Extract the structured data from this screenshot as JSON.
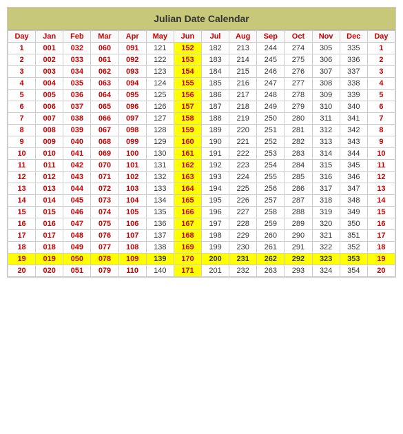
{
  "title": "Julian Date Calendar",
  "headers": [
    "Day",
    "Jan",
    "Feb",
    "Mar",
    "Apr",
    "May",
    "Jun",
    "Jul",
    "Aug",
    "Sep",
    "Oct",
    "Nov",
    "Dec",
    "Day"
  ],
  "rows": [
    {
      "day": 1,
      "jan": "001",
      "feb": "032",
      "mar": "060",
      "apr": "091",
      "may": "121",
      "jun": "152",
      "jul": "182",
      "aug": "213",
      "sep": "244",
      "oct": "274",
      "nov": "305",
      "dec": "335"
    },
    {
      "day": 2,
      "jan": "002",
      "feb": "033",
      "mar": "061",
      "apr": "092",
      "may": "122",
      "jun": "153",
      "jul": "183",
      "aug": "214",
      "sep": "245",
      "oct": "275",
      "nov": "306",
      "dec": "336"
    },
    {
      "day": 3,
      "jan": "003",
      "feb": "034",
      "mar": "062",
      "apr": "093",
      "may": "123",
      "jun": "154",
      "jul": "184",
      "aug": "215",
      "sep": "246",
      "oct": "276",
      "nov": "307",
      "dec": "337"
    },
    {
      "day": 4,
      "jan": "004",
      "feb": "035",
      "mar": "063",
      "apr": "094",
      "may": "124",
      "jun": "155",
      "jul": "185",
      "aug": "216",
      "sep": "247",
      "oct": "277",
      "nov": "308",
      "dec": "338"
    },
    {
      "day": 5,
      "jan": "005",
      "feb": "036",
      "mar": "064",
      "apr": "095",
      "may": "125",
      "jun": "156",
      "jul": "186",
      "aug": "217",
      "sep": "248",
      "oct": "278",
      "nov": "309",
      "dec": "339"
    },
    {
      "day": 6,
      "jan": "006",
      "feb": "037",
      "mar": "065",
      "apr": "096",
      "may": "126",
      "jun": "157",
      "jul": "187",
      "aug": "218",
      "sep": "249",
      "oct": "279",
      "nov": "310",
      "dec": "340"
    },
    {
      "day": 7,
      "jan": "007",
      "feb": "038",
      "mar": "066",
      "apr": "097",
      "may": "127",
      "jun": "158",
      "jul": "188",
      "aug": "219",
      "sep": "250",
      "oct": "280",
      "nov": "311",
      "dec": "341"
    },
    {
      "day": 8,
      "jan": "008",
      "feb": "039",
      "mar": "067",
      "apr": "098",
      "may": "128",
      "jun": "159",
      "jul": "189",
      "aug": "220",
      "sep": "251",
      "oct": "281",
      "nov": "312",
      "dec": "342"
    },
    {
      "day": 9,
      "jan": "009",
      "feb": "040",
      "mar": "068",
      "apr": "099",
      "may": "129",
      "jun": "160",
      "jul": "190",
      "aug": "221",
      "sep": "252",
      "oct": "282",
      "nov": "313",
      "dec": "343"
    },
    {
      "day": 10,
      "jan": "010",
      "feb": "041",
      "mar": "069",
      "apr": "100",
      "may": "130",
      "jun": "161",
      "jul": "191",
      "aug": "222",
      "sep": "253",
      "oct": "283",
      "nov": "314",
      "dec": "344"
    },
    {
      "day": 11,
      "jan": "011",
      "feb": "042",
      "mar": "070",
      "apr": "101",
      "may": "131",
      "jun": "162",
      "jul": "192",
      "aug": "223",
      "sep": "254",
      "oct": "284",
      "nov": "315",
      "dec": "345"
    },
    {
      "day": 12,
      "jan": "012",
      "feb": "043",
      "mar": "071",
      "apr": "102",
      "may": "132",
      "jun": "163",
      "jul": "193",
      "aug": "224",
      "sep": "255",
      "oct": "285",
      "nov": "316",
      "dec": "346"
    },
    {
      "day": 13,
      "jan": "013",
      "feb": "044",
      "mar": "072",
      "apr": "103",
      "may": "133",
      "jun": "164",
      "jul": "194",
      "aug": "225",
      "sep": "256",
      "oct": "286",
      "nov": "317",
      "dec": "347"
    },
    {
      "day": 14,
      "jan": "014",
      "feb": "045",
      "mar": "073",
      "apr": "104",
      "may": "134",
      "jun": "165",
      "jul": "195",
      "aug": "226",
      "sep": "257",
      "oct": "287",
      "nov": "318",
      "dec": "348"
    },
    {
      "day": 15,
      "jan": "015",
      "feb": "046",
      "mar": "074",
      "apr": "105",
      "may": "135",
      "jun": "166",
      "jul": "196",
      "aug": "227",
      "sep": "258",
      "oct": "288",
      "nov": "319",
      "dec": "349"
    },
    {
      "day": 16,
      "jan": "016",
      "feb": "047",
      "mar": "075",
      "apr": "106",
      "may": "136",
      "jun": "167",
      "jul": "197",
      "aug": "228",
      "sep": "259",
      "oct": "289",
      "nov": "320",
      "dec": "350"
    },
    {
      "day": 17,
      "jan": "017",
      "feb": "048",
      "mar": "076",
      "apr": "107",
      "may": "137",
      "jun": "168",
      "jul": "198",
      "aug": "229",
      "sep": "260",
      "oct": "290",
      "nov": "321",
      "dec": "351"
    },
    {
      "day": 18,
      "jan": "018",
      "feb": "049",
      "mar": "077",
      "apr": "108",
      "may": "138",
      "jun": "169",
      "jul": "199",
      "aug": "230",
      "sep": "261",
      "oct": "291",
      "nov": "322",
      "dec": "352"
    },
    {
      "day": 19,
      "jan": "019",
      "feb": "050",
      "mar": "078",
      "apr": "109",
      "may": "139",
      "jun": "170",
      "jul": "200",
      "aug": "231",
      "sep": "262",
      "oct": "292",
      "nov": "323",
      "dec": "353"
    },
    {
      "day": 20,
      "jan": "020",
      "feb": "051",
      "mar": "079",
      "apr": "110",
      "may": "140",
      "jun": "171",
      "jul": "201",
      "aug": "232",
      "sep": "263",
      "oct": "293",
      "nov": "324",
      "dec": "354"
    }
  ],
  "jun_highlight_rows": [
    1,
    2,
    3,
    4,
    5,
    6,
    7,
    8,
    9,
    10,
    11,
    12,
    13,
    14,
    15,
    16,
    17,
    18,
    19,
    20
  ],
  "row19_full_highlight": true
}
